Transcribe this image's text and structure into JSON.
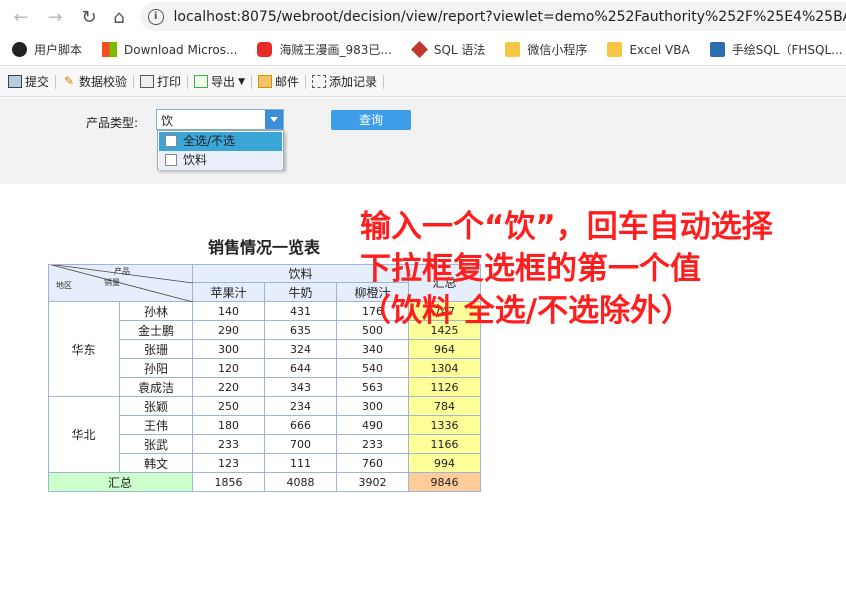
{
  "browser": {
    "url": "localhost:8075/webroot/decision/view/report?viewlet=demo%252Fauthority%252F%25E4%25BA%25",
    "bookmarks": [
      {
        "label": "用户脚本",
        "icon": "user-script-icon"
      },
      {
        "label": "Download Micros...",
        "icon": "microsoft-icon"
      },
      {
        "label": "海贼王漫画_983已...",
        "icon": "comic-site-icon"
      },
      {
        "label": "SQL 语法",
        "icon": "sql-icon"
      },
      {
        "label": "微信小程序",
        "icon": "folder-icon"
      },
      {
        "label": "Excel VBA",
        "icon": "folder-icon"
      },
      {
        "label": "手绘SQL（FHSQL...",
        "icon": "sap-icon"
      }
    ]
  },
  "toolbar": {
    "submit": "提交",
    "validate": "数据校验",
    "print": "打印",
    "export": "导出",
    "mail": "邮件",
    "add_record": "添加记录"
  },
  "params": {
    "label": "产品类型:",
    "combo_value": "饮",
    "options": [
      "全选/不选",
      "饮料"
    ],
    "query_button": "查询"
  },
  "report": {
    "title": "销售情况一览表",
    "corner_product": "产品",
    "corner_sales": "销量",
    "corner_region": "地区",
    "group_header": "饮料",
    "total_header": "汇总",
    "columns": [
      "苹果汁",
      "牛奶",
      "柳橙汁"
    ],
    "regions": [
      {
        "name": "华东",
        "rows": [
          {
            "name": "孙林",
            "values": [
              "140",
              "431",
              "176"
            ],
            "total": "747"
          },
          {
            "name": "金士鹏",
            "values": [
              "290",
              "635",
              "500"
            ],
            "total": "1425"
          },
          {
            "name": "张珊",
            "values": [
              "300",
              "324",
              "340"
            ],
            "total": "964"
          },
          {
            "name": "孙阳",
            "values": [
              "120",
              "644",
              "540"
            ],
            "total": "1304"
          },
          {
            "name": "袁成洁",
            "values": [
              "220",
              "343",
              "563"
            ],
            "total": "1126"
          }
        ]
      },
      {
        "name": "华北",
        "rows": [
          {
            "name": "张颖",
            "values": [
              "250",
              "234",
              "300"
            ],
            "total": "784"
          },
          {
            "name": "王伟",
            "values": [
              "180",
              "666",
              "490"
            ],
            "total": "1336"
          },
          {
            "name": "张武",
            "values": [
              "233",
              "700",
              "233"
            ],
            "total": "1166"
          },
          {
            "name": "韩文",
            "values": [
              "123",
              "111",
              "760"
            ],
            "total": "994"
          }
        ]
      }
    ],
    "summary": {
      "label": "汇总",
      "values": [
        "1856",
        "4088",
        "3902"
      ],
      "total": "9846"
    }
  },
  "annotation": {
    "line1": "输入一个“饮”，回车自动选择",
    "line2": "下拉框复选框的第一个值",
    "line3": "（饮料  全选/不选除外）"
  }
}
